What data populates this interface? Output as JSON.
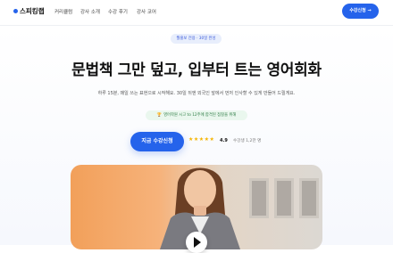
{
  "header": {
    "logo": "스피킹랩",
    "nav": [
      "커리큘럼",
      "강사 소개",
      "수강 후기",
      "강사 코어"
    ],
    "cta": "수강신청 →"
  },
  "hero": {
    "pill": "월홍보 전용 · 30일 완성",
    "headline": "문법책 그만 덮고, 입부터 트는 영어회화",
    "subtext": "하루 15분, 매일 쓰는 표현으로 시작해요. 30일 뒤엔 외국인 앞에서 먼저 인사할 수 있게 만들어 드릴게요.",
    "badge_icon": "trophy-icon",
    "badge": "영어학원 시고 to 12주에 합격된 점찰을 위해",
    "cta": "지금 수강신청",
    "stars": "★★★★★",
    "rating": "4.9",
    "reviews": "수강생 1,2만 명"
  },
  "video": {
    "play_icon": "play-icon"
  },
  "colors": {
    "accent": "#2563eb",
    "star": "#f5b400",
    "badge_bg": "#eaf7ee"
  }
}
